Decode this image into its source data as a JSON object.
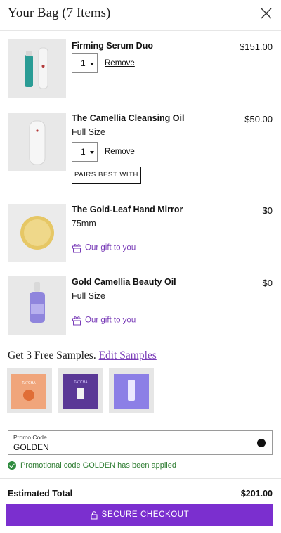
{
  "header": {
    "title": "Your Bag (7 Items)",
    "close_icon": "close-icon"
  },
  "items": [
    {
      "name": "Firming Serum Duo",
      "price": "$151.00",
      "quantity": "1",
      "remove_label": "Remove"
    },
    {
      "name": "The Camellia Cleansing Oil",
      "variant": "Full Size",
      "price": "$50.00",
      "quantity": "1",
      "remove_label": "Remove",
      "pairs_label": "PAIRS BEST WITH"
    },
    {
      "name": "The Gold-Leaf Hand Mirror",
      "variant": "75mm",
      "price": "$0",
      "gift_label": "Our gift to you"
    },
    {
      "name": "Gold Camellia Beauty Oil",
      "variant": "Full Size",
      "price": "$0",
      "gift_label": "Our gift to you"
    }
  ],
  "samples": {
    "title": "Get 3 Free Samples.",
    "edit_link": "Edit Samples",
    "brand_text": "TATCHA"
  },
  "promo": {
    "label": "Promo Code",
    "value": "GOLDEN",
    "applied_message": "Promotional code GOLDEN has been applied"
  },
  "summary": {
    "total_label": "Estimated Total",
    "total_value": "$201.00"
  },
  "checkout": {
    "label": "SECURE CHECKOUT"
  },
  "colors": {
    "accent": "#7b2fcf",
    "gift_text": "#7a3db8",
    "success": "#2e8b3e"
  }
}
